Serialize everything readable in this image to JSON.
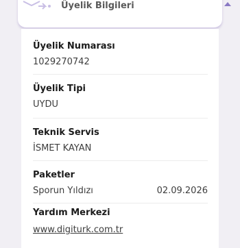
{
  "header": {
    "title": "Üyelik Bilgileri",
    "icon": "membership-icon",
    "collapse_icon": "chevron-up-icon"
  },
  "details": {
    "membership_number": {
      "label": "Üyelik Numarası",
      "value": "1029270742"
    },
    "membership_type": {
      "label": "Üyelik Tipi",
      "value": "UYDU"
    },
    "technical_service": {
      "label": "Teknik Servis",
      "value": "İSMET KAYAN"
    },
    "packages": {
      "label": "Paketler",
      "name": "Sporun Yıldızı",
      "date": "02.09.2026"
    },
    "help_center": {
      "label": "Yardım Merkezi",
      "link": "www.digiturk.com.tr"
    }
  },
  "colors": {
    "background": "#f1eff4",
    "accent": "#8a79c4"
  }
}
